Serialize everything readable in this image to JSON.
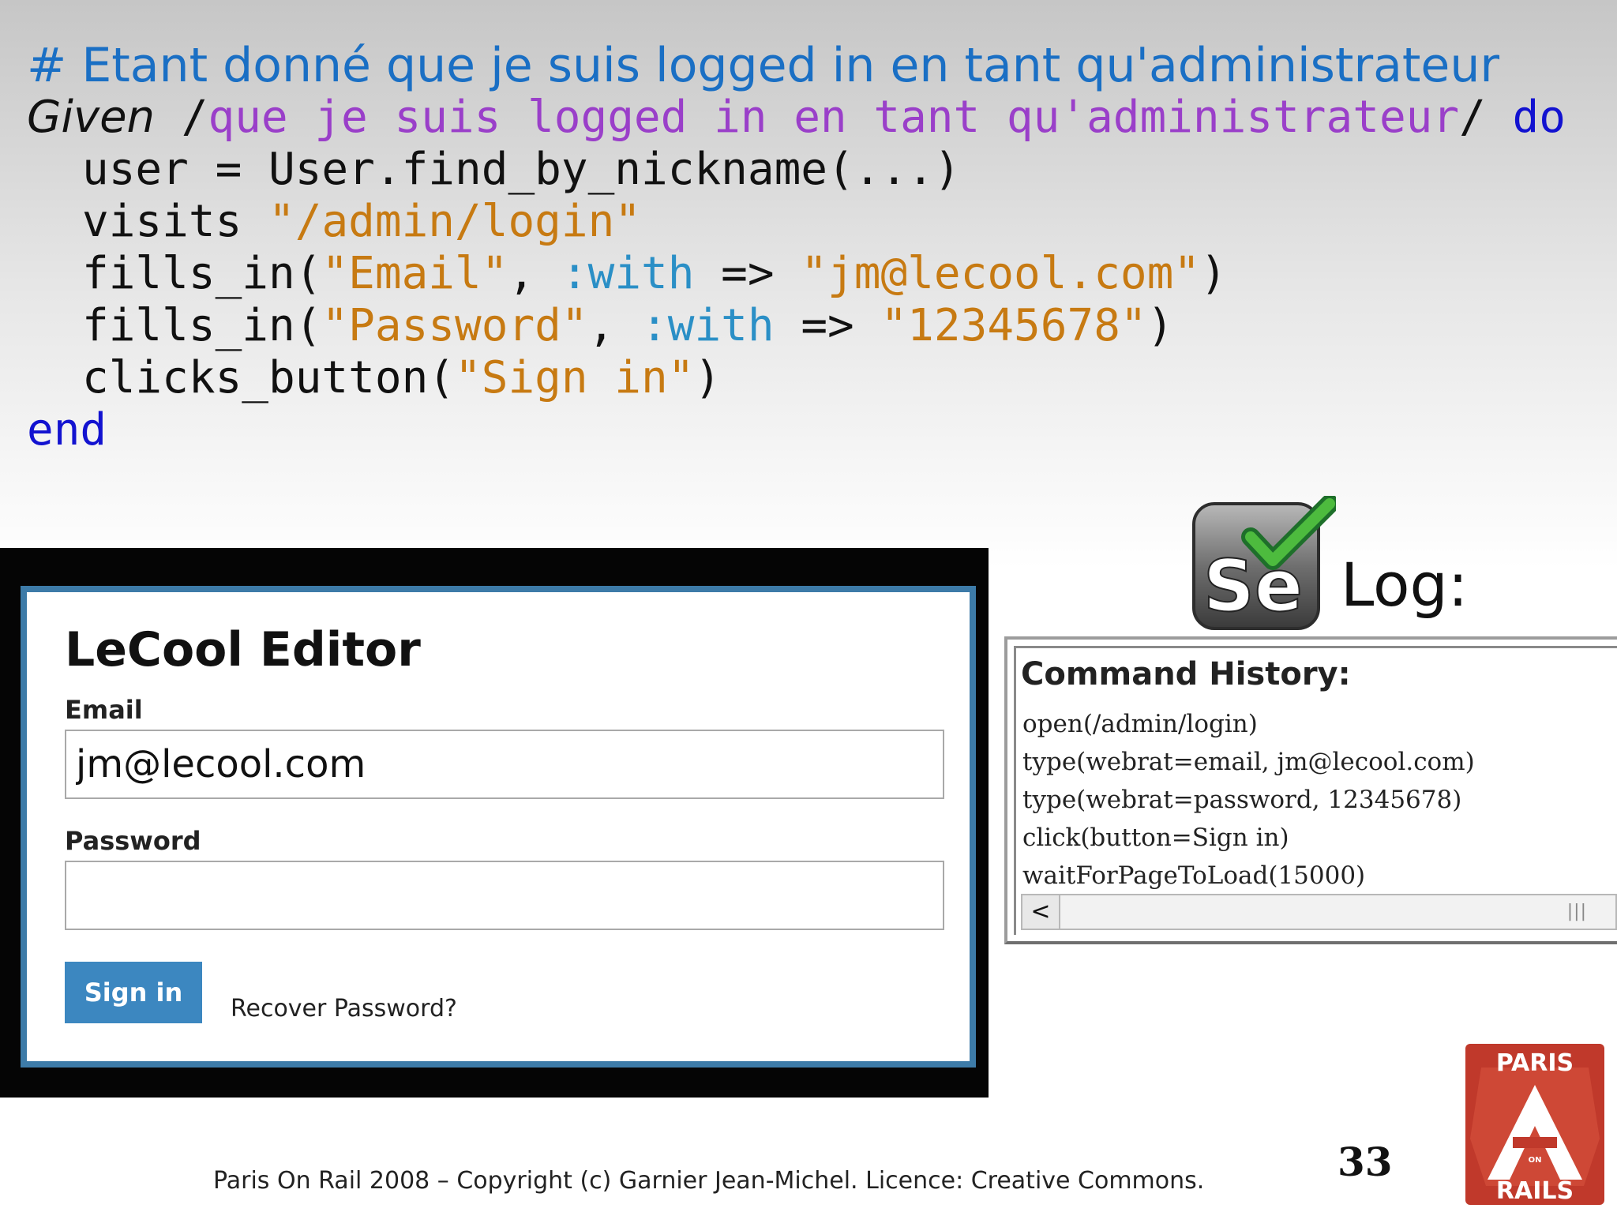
{
  "code": {
    "comment": "# Etant donné que je suis logged in en tant qu'administrateur",
    "given_keyword": "Given",
    "regex_open": " /",
    "regex": "que je suis logged in en tant qu'administrateur",
    "regex_close": "/ ",
    "do_keyword": "do",
    "line_user": "user = User.find_by_nickname(...)",
    "visits_call": "visits ",
    "visits_arg": "\"/admin/login\"",
    "fills_in_call": "fills_in(",
    "email_label_arg": "\"Email\"",
    "comma": ", ",
    "with_symbol": ":with",
    "arrow": " => ",
    "email_value_arg": "\"jm@lecool.com\"",
    "close_paren": ")",
    "password_label_arg": "\"Password\"",
    "password_value_arg": "\"12345678\"",
    "clicks_button_call": "clicks_button(",
    "sign_in_arg": "\"Sign in\"",
    "end_keyword": "end"
  },
  "login_form": {
    "title": "LeCool Editor",
    "email_label": "Email",
    "email_value": "jm@lecool.com",
    "password_label": "Password",
    "password_value": "",
    "sign_in_button": "Sign in",
    "recover_link": "Recover Password?"
  },
  "selenium": {
    "logo_text": "Se",
    "log_heading": "Log:",
    "history_title": "Command History:",
    "commands": [
      "open(/admin/login)",
      "type(webrat=email, jm@lecool.com)",
      "type(webrat=password, 12345678)",
      "click(button=Sign in)",
      "waitForPageToLoad(15000)"
    ],
    "scroll_left_glyph": "<",
    "scroll_grip_glyph": "|||"
  },
  "footer": {
    "copyright": "Paris On Rail 2008 – Copyright (c) Garnier Jean-Michel. Licence: Creative Commons.",
    "page_number": "33"
  },
  "paris_on_rails_logo": {
    "top_text": "PARIS",
    "middle_text": "ON",
    "bottom_text": "RAILS"
  },
  "colors": {
    "comment": "#1a6fc4",
    "regex": "#9a3fc9",
    "keyword": "#1212d0",
    "string": "#c77a12",
    "symbol": "#2a8fc6",
    "login_border": "#3d7ba8",
    "sign_in_button": "#3c87c0",
    "logo_red": "#c0392b"
  }
}
